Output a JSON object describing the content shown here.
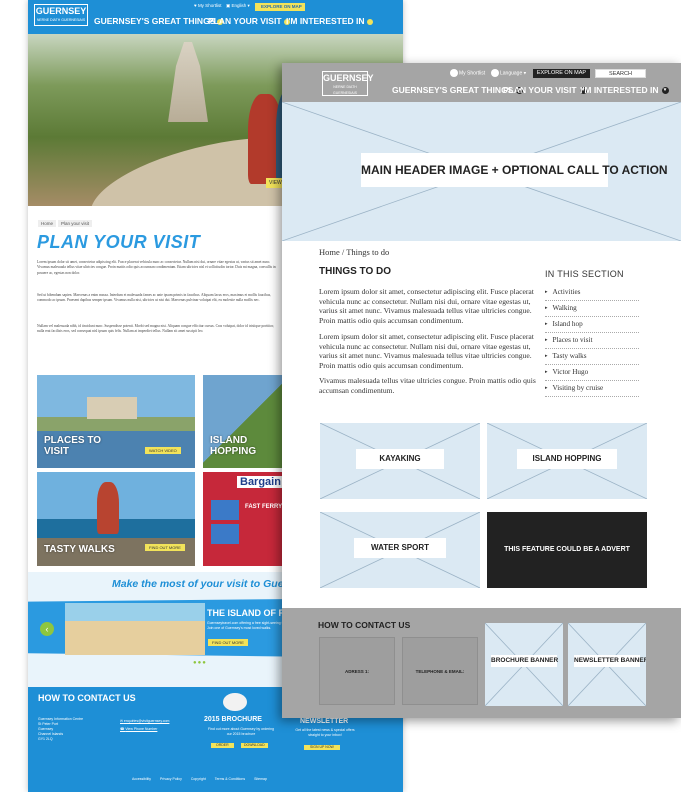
{
  "back": {
    "logo": {
      "main": "GUERNSEY",
      "sub": "NERNE DIATH GUERNESIAIS"
    },
    "util": {
      "shortlist": "My Shortlist",
      "lang": "English",
      "explore": "EXPLORE ON MAP"
    },
    "nav": [
      "GUERNSEY'S GREAT THINGS",
      "PLAN YOUR VISIT",
      "I'M INTERESTED IN"
    ],
    "hero_button": "VIEW",
    "breadcrumb": [
      "Home",
      "Plan your visit"
    ],
    "title": "PLAN YOUR VISIT",
    "paragraphs": [
      "Lorem ipsum dolor sit amet, consectetur adipiscing elit. Fusce placerat vehicula nunc ac consectetur. Nullam nisi dui, ornare vitae egestas ut, varius sit amet nunc. Vivamus malesuada tellus vitae ultricies congue. Proin mattis odio quis accumsan condimentum. Etiam ultricies nisl et sollicitudin tortor. Duis mi magna, convallis in posuere ac, egestas non dolor.",
      "Sed ut bibendum sapien. Maecenas a enim massa. Interdum et malesuada fames ac ante ipsum primis in faucibus. Aliquam lacus eros, maximus et mollis faucibus, commodo ac ipsum. Praesent dapibus semper ipsum. Vivamus nulla nisi, ultricies ut nisi dui. Maecenas pulvinar volutpat elit, eu molestie nulla mollis nec.",
      "Nullam vel malesuada nibh, id tincidunt nunc. Suspendisse potenti. Morbi sed magna nisi. Aliquam congue efficitur cursus. Cras volutpat, dolor id tristique porttitor, nulla erat facilisis eros, sed consequat nisl ipsum quis felis. Nullam at imperdiet tellus. Nullam sit amet suscipit leo."
    ],
    "tiles": [
      {
        "label": "PLACES TO\nVISIT",
        "button": "WATCH VIDEO"
      },
      {
        "label": "ISLAND\nHOPPING",
        "button": ""
      },
      {
        "label": "TASTY WALKS",
        "button": "FIND OUT MORE"
      },
      {
        "label": "Bargain",
        "button": "FAST FERRY WI"
      }
    ],
    "make": {
      "tagline": "Make the most of your visit to Guernsey",
      "island_title": "THE ISLAND OF RO",
      "island_text": "Guernseytravel.com offering a free sight-seeing trip to every visitor. Join one of Guernsey's most loved walks.",
      "find_out": "FIND OUT MORE",
      "arrow": "‹",
      "dots": "●●●"
    },
    "footer": {
      "heading": "HOW TO CONTACT US",
      "address": "Guernsey Information Centre\nSt Peter Port\nGuernsey\nChannel Islands\nGY1 2LQ",
      "email": "enquiries@visitguernsey.com",
      "phone": "View Phone Number",
      "brochure": "2015 BROCHURE",
      "brochure_text": "Find out more about Guernsey by ordering our 2015 brochure",
      "order": "ORDER",
      "download": "DOWNLOAD",
      "newsletter": "NEWSLETTER",
      "newsletter_text": "Get all the latest news & special offers straight to your inbox!",
      "signup": "SIGN UP NOW",
      "links": [
        "Accessibility",
        "Privacy Policy",
        "Copyright",
        "Terms & Conditions",
        "Sitemap"
      ]
    }
  },
  "front": {
    "logo": {
      "main": "GUERNSEY",
      "sub": "NERNE DIATH GUERNESIAIS"
    },
    "util": {
      "shortlist": "My Shortlist",
      "language": "Language",
      "explore": "EXPLORE ON MAP",
      "search": "SEARCH"
    },
    "nav": [
      "GUERNSEY'S GREAT THINGS",
      "PLAN YOUR VISIT",
      "I'M INTERESTED IN"
    ],
    "hero_cta": "MAIN HEADER IMAGE + OPTIONAL CALL TO ACTION",
    "breadcrumb": "Home  /  Things to do",
    "heading": "THINGS TO DO",
    "paragraphs": [
      "Lorem ipsum dolor sit amet, consectetur adipiscing elit. Fusce placerat vehicula nunc ac consectetur. Nullam nisi dui, ornare vitae egestas ut, varius sit amet nunc. Vivamus malesuada tellus vitae ultricies congue. Proin mattis odio quis accumsan condimentum.",
      "Lorem ipsum dolor sit amet, consectetur adipiscing elit. Fusce placerat vehicula nunc ac consectetur. Nullam nisi dui, ornare vitae egestas ut, varius sit amet nunc. Vivamus malesuada tellus vitae ultricies congue. Proin mattis odio quis accumsan condimentum.",
      "Vivamus malesuada tellus vitae ultricies congue. Proin mattis odio quis accumsan condimentum."
    ],
    "section_heading": "IN THIS SECTION",
    "section_items": [
      "Activities",
      "Walking",
      "Island hop",
      "Places to visit",
      "Tasty walks",
      "Victor Hugo",
      "Visiting by cruise"
    ],
    "tiles": [
      "KAYAKING",
      "ISLAND HOPPING",
      "WATER SPORT"
    ],
    "advert": "THIS FEATURE COULD BE A ADVERT",
    "contact": {
      "heading": "HOW TO CONTACT US",
      "address": "ADRESS 1:",
      "tel": "TELEPHONE & EMAIL:",
      "brochure": "BROCHURE BANNER",
      "newsletter": "NEWSLETTER BANNER"
    }
  }
}
